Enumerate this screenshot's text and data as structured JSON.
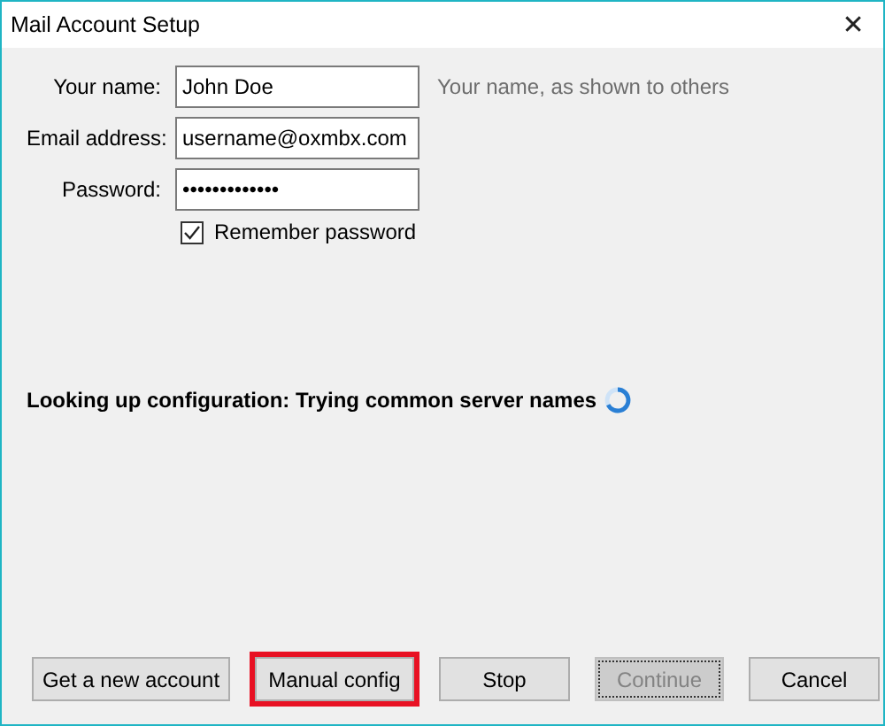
{
  "window": {
    "title": "Mail Account Setup",
    "close": "✕"
  },
  "fields": [
    {
      "label": "Your name:",
      "value": "John Doe",
      "hint": "Your name, as shown to others"
    },
    {
      "label": "Email address:",
      "value": "username@oxmbx.com"
    },
    {
      "label": "Password:",
      "value": "•••••••••••••"
    }
  ],
  "remember": {
    "label": "Remember password",
    "checked": true
  },
  "status": {
    "text": "Looking up configuration: Trying common server names",
    "busy": true
  },
  "buttons": [
    {
      "label": "Get a new account",
      "disabled": false,
      "highlighted": false,
      "focused": false
    },
    {
      "label": "Manual config",
      "disabled": false,
      "highlighted": true,
      "focused": false
    },
    {
      "label": "Stop",
      "disabled": false,
      "highlighted": false,
      "focused": false
    },
    {
      "label": "Continue",
      "disabled": true,
      "highlighted": false,
      "focused": true
    },
    {
      "label": "Cancel",
      "disabled": false,
      "highlighted": false,
      "focused": false
    }
  ]
}
